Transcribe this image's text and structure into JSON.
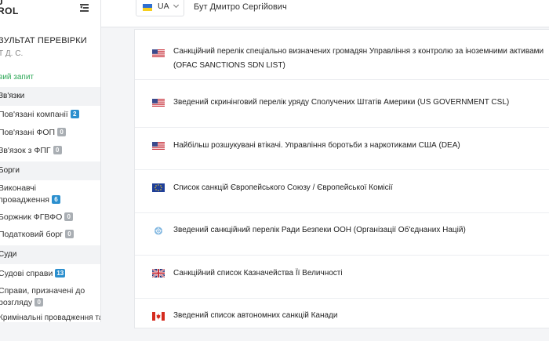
{
  "sidebar": {
    "logo_line1": "J",
    "logo_line2": "ROL",
    "result_title": "ЗУЛЬТАТ ПЕРЕВІРКИ",
    "result_subtitle": "Т Д. С.",
    "new_request": "вий запит",
    "sections": [
      {
        "label": "Зв'язки"
      },
      {
        "label": "Борги"
      },
      {
        "label": "Суди"
      }
    ],
    "items": [
      {
        "label": "Пов'язані компанії",
        "badge": "2"
      },
      {
        "label": "Пов'язані ФОП",
        "badge": "0"
      },
      {
        "label": "Зв'язок з ФПГ",
        "badge": "0"
      },
      {
        "label": "Виконавчі",
        "label2": "провадження",
        "badge": "6"
      },
      {
        "label": "Боржник ФГВФО",
        "badge": "0"
      },
      {
        "label": "Податковий борг",
        "badge": "0"
      },
      {
        "label": "Судові справи",
        "badge": "13"
      },
      {
        "label": "Справи, призначені до",
        "label2": "розгляду",
        "badge": "0"
      }
    ],
    "partial_item": "Кримінальні провадження та Розшук",
    "badge_colors": {
      "blue": "#2b8fce",
      "grey": "#a9aeb3"
    }
  },
  "header": {
    "language": "UA",
    "user_name": "Бут Дмитро Сергійович"
  },
  "sanctions": [
    {
      "flag": "us-flag-icon",
      "line1": "Санкційний перелік спеціально визначених громадян Управління з контролю за іноземними активами",
      "line2": "(OFAC SANCTIONS SDN LIST)"
    },
    {
      "flag": "us-flag-icon",
      "line1": "Зведений скринінговий перелік уряду Сполучених Штатів Америки (US GOVERNMENT CSL)"
    },
    {
      "flag": "us-flag-icon",
      "line1": "Найбільш розшукувані втікачі. Управління боротьби з наркотиками США (DEA)"
    },
    {
      "flag": "eu-flag-icon",
      "line1": "Список санкцій Європейського Союзу / Європейської Комісії"
    },
    {
      "flag": "un-flag-icon",
      "line1": "Зведений санкційний перелік Ради Безпеки ООН (Організації Об'єднаних Націй)"
    },
    {
      "flag": "uk-flag-icon",
      "line1": "Санкційний список Казначейства Її Величності"
    },
    {
      "flag": "canada-flag-icon",
      "line1": "Зведений список автономних санкцій Канади"
    }
  ]
}
